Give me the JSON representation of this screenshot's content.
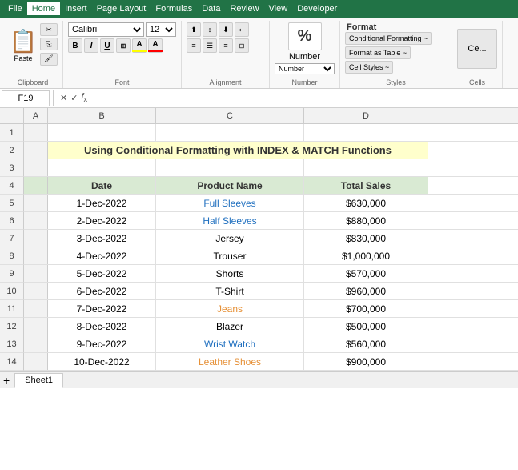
{
  "menubar": {
    "items": [
      "File",
      "Home",
      "Insert",
      "Page Layout",
      "Formulas",
      "Data",
      "Review",
      "View",
      "Developer"
    ]
  },
  "ribbon": {
    "groups": {
      "clipboard": {
        "label": "Clipboard",
        "paste": "📋",
        "paste_label": "Paste"
      },
      "font": {
        "label": "Font",
        "font_name": "Calibri",
        "font_size": "12",
        "bold": "B",
        "italic": "I",
        "underline": "U"
      },
      "alignment": {
        "label": "Alignment"
      },
      "number": {
        "label": "Number",
        "symbol": "%",
        "type_label": "Number"
      },
      "styles": {
        "label": "Styles",
        "conditional_formatting": "Conditional Formatting ~",
        "format_as_table": "Format as Table ~",
        "cell_styles": "Cell Styles ~",
        "format_label": "Format"
      },
      "cells": {
        "label": "Cells",
        "format_label": "Ce..."
      }
    }
  },
  "formula_bar": {
    "cell_ref": "F19",
    "placeholder": ""
  },
  "spreadsheet": {
    "col_headers": [
      "A",
      "B",
      "C",
      "D"
    ],
    "title": "Using Conditional Formatting with INDEX & MATCH Functions",
    "table_headers": [
      "Date",
      "Product Name",
      "Total Sales"
    ],
    "rows": [
      {
        "num": "1",
        "data": []
      },
      {
        "num": "2",
        "data": [
          "title"
        ]
      },
      {
        "num": "3",
        "data": []
      },
      {
        "num": "4",
        "data": [
          "header"
        ]
      },
      {
        "num": "5",
        "date": "1-Dec-2022",
        "product": "Full Sleeves",
        "product_color": "blue",
        "sales": "$630,000"
      },
      {
        "num": "6",
        "date": "2-Dec-2022",
        "product": "Half Sleeves",
        "product_color": "blue",
        "sales": "$880,000"
      },
      {
        "num": "7",
        "date": "3-Dec-2022",
        "product": "Jersey",
        "product_color": "default",
        "sales": "$830,000"
      },
      {
        "num": "8",
        "date": "4-Dec-2022",
        "product": "Trouser",
        "product_color": "default",
        "sales": "$1,000,000"
      },
      {
        "num": "9",
        "date": "5-Dec-2022",
        "product": "Shorts",
        "product_color": "default",
        "sales": "$570,000"
      },
      {
        "num": "10",
        "date": "6-Dec-2022",
        "product": "T-Shirt",
        "product_color": "default",
        "sales": "$960,000"
      },
      {
        "num": "11",
        "date": "7-Dec-2022",
        "product": "Jeans",
        "product_color": "orange",
        "sales": "$700,000"
      },
      {
        "num": "12",
        "date": "8-Dec-2022",
        "product": "Blazer",
        "product_color": "default",
        "sales": "$500,000"
      },
      {
        "num": "13",
        "date": "9-Dec-2022",
        "product": "Wrist Watch",
        "product_color": "blue",
        "sales": "$560,000"
      },
      {
        "num": "14",
        "date": "10-Dec-2022",
        "product": "Leather Shoes",
        "product_color": "orange",
        "sales": "$900,000"
      }
    ],
    "sheet_tab": "Sheet1"
  }
}
